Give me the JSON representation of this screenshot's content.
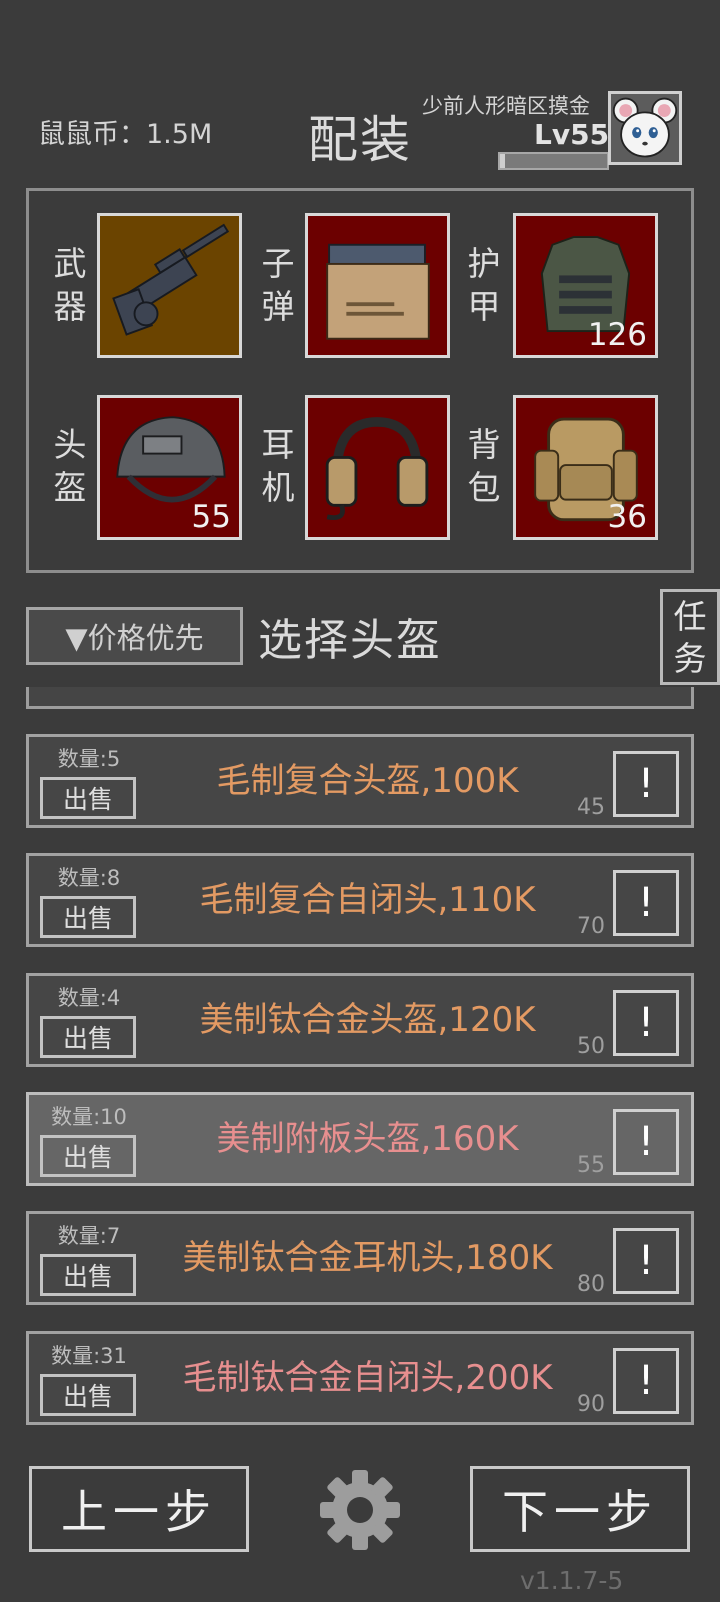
{
  "header": {
    "coins": "鼠鼠币：1.5M",
    "title": "配装",
    "player_name": "少前人形暗区摸金",
    "level": "Lv55",
    "xp_fraction": 0.05
  },
  "slots": [
    {
      "label": "武器",
      "count": "",
      "icon": "machine-gun-icon"
    },
    {
      "label": "子弹",
      "count": "",
      "icon": "ammo-box-icon"
    },
    {
      "label": "护甲",
      "count": "126",
      "icon": "body-armor-icon"
    },
    {
      "label": "头盔",
      "count": "55",
      "icon": "helmet-icon"
    },
    {
      "label": "耳机",
      "count": "",
      "icon": "headset-icon"
    },
    {
      "label": "背包",
      "count": "36",
      "icon": "backpack-icon"
    }
  ],
  "sort": {
    "label": "▼价格优先"
  },
  "select_title": "选择头盔",
  "task_button": {
    "label": "任务"
  },
  "items": [
    {
      "qty": "数量:5",
      "sell": "出售",
      "name": "毛制复合头盔,100K",
      "level": "45",
      "info": "!"
    },
    {
      "qty": "数量:8",
      "sell": "出售",
      "name": "毛制复合自闭头,110K",
      "level": "70",
      "info": "!"
    },
    {
      "qty": "数量:4",
      "sell": "出售",
      "name": "美制钛合金头盔,120K",
      "level": "50",
      "info": "!"
    },
    {
      "qty": "数量:10",
      "sell": "出售",
      "name": "美制附板头盔,160K",
      "level": "55",
      "info": "!"
    },
    {
      "qty": "数量:7",
      "sell": "出售",
      "name": "美制钛合金耳机头,180K",
      "level": "80",
      "info": "!"
    },
    {
      "qty": "数量:31",
      "sell": "出售",
      "name": "毛制钛合金自闭头,200K",
      "level": "90",
      "info": "!"
    }
  ],
  "footer": {
    "prev": "上一步",
    "next": "下一步",
    "version": "v1.1.7-5"
  },
  "colors": {
    "background": "#3b3b3b",
    "slot_bg": "#6c0000",
    "weapon_slot_bg": "#6b4400",
    "item_orange": "#e39a63",
    "item_pink": "#e78f8f"
  }
}
